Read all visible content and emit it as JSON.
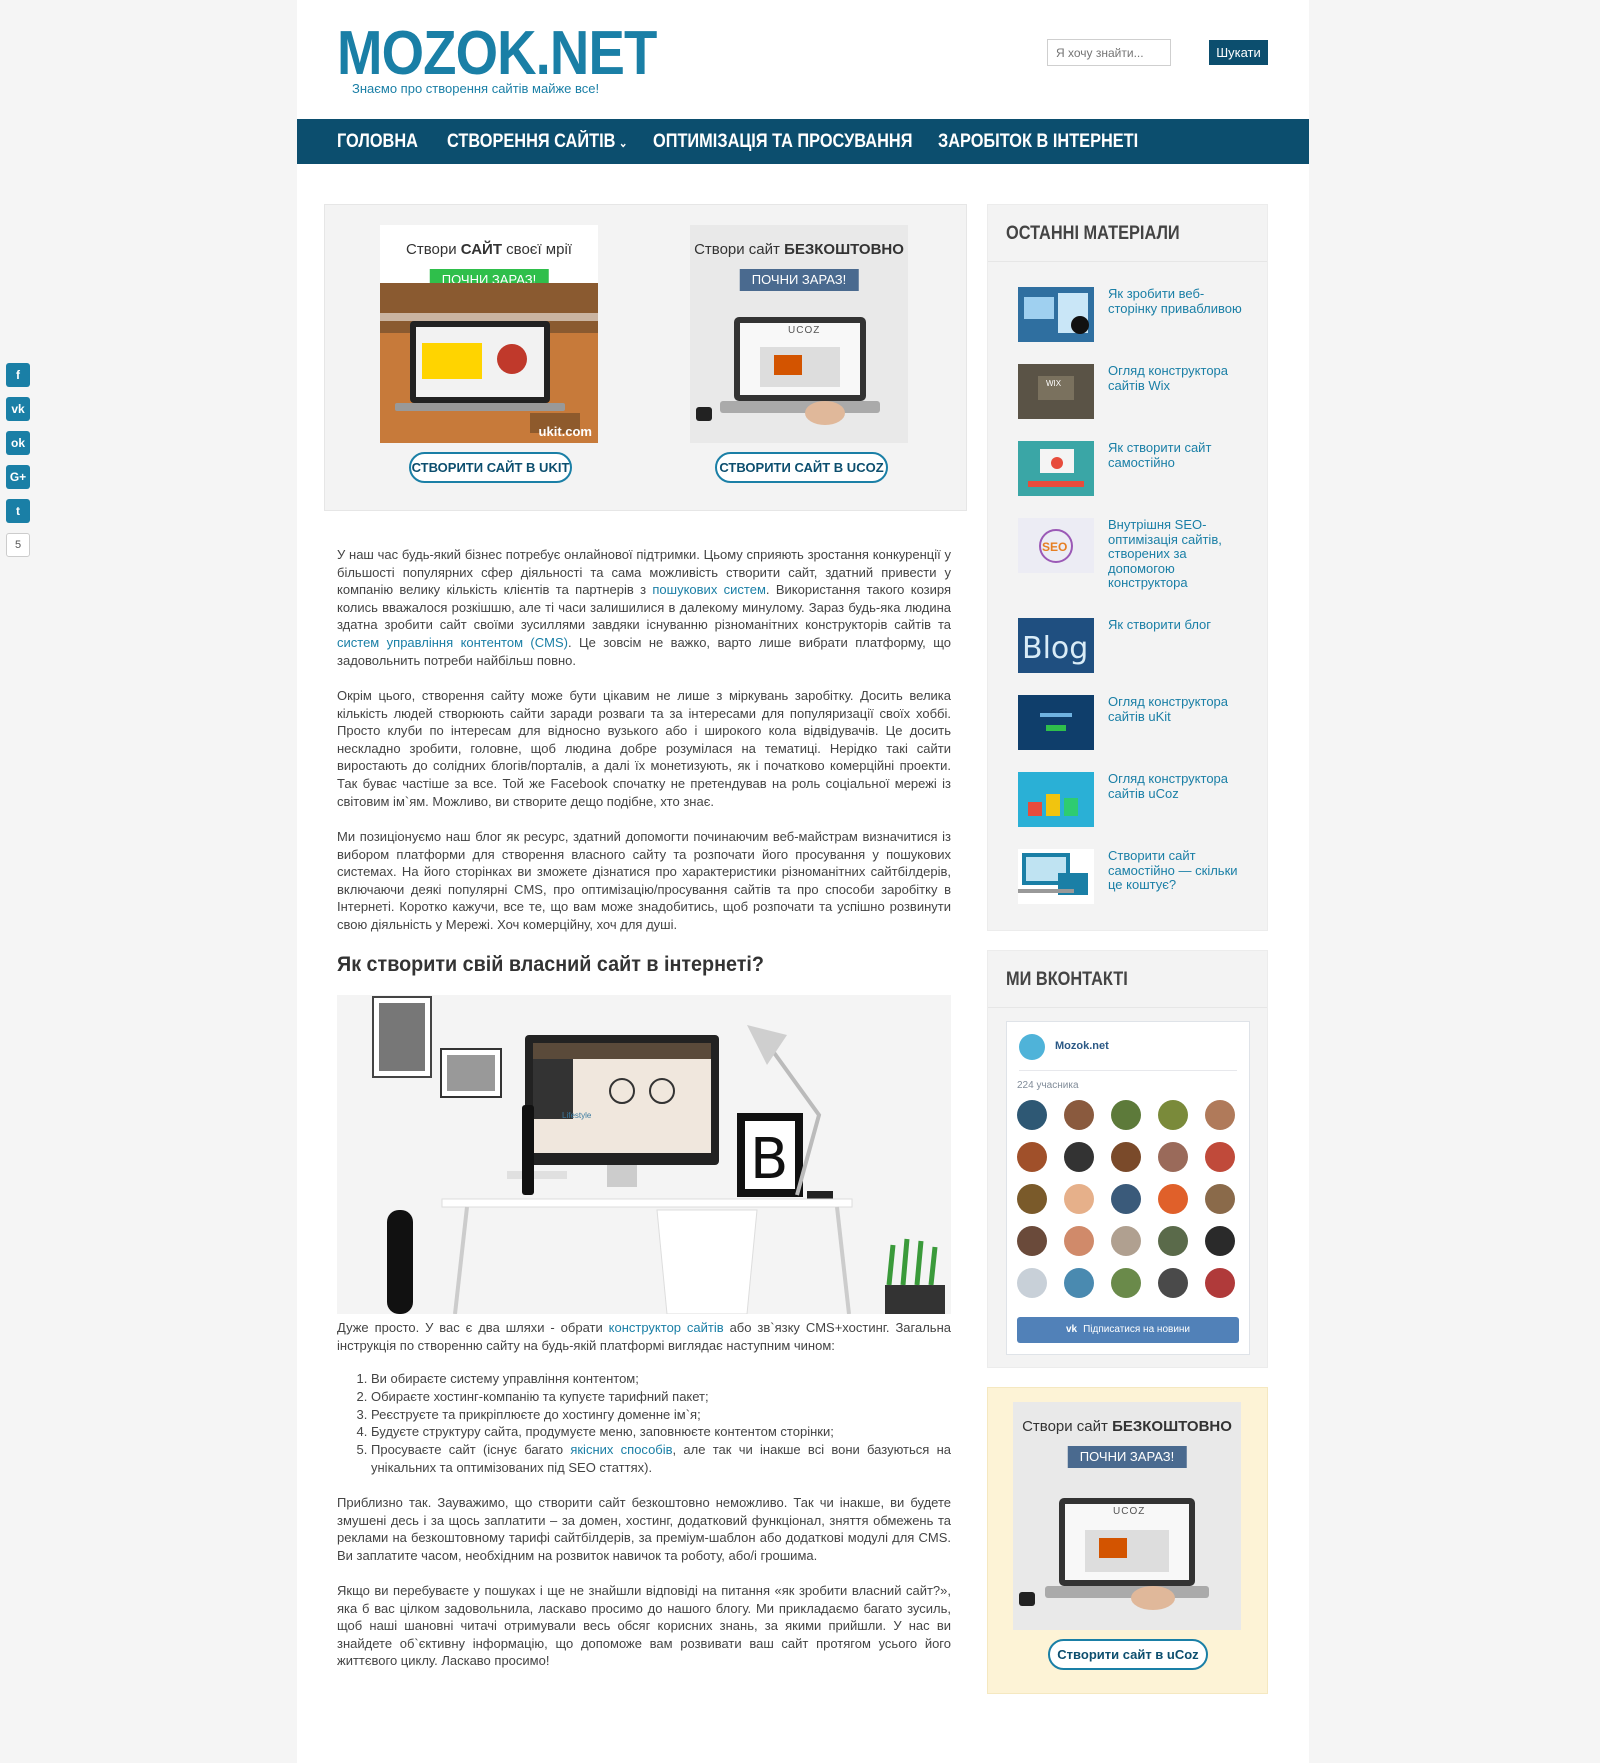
{
  "header": {
    "logo": "MOZOK.NET",
    "tagline": "Знаємо про створення сайтів майже все!",
    "search_placeholder": "Я хочу знайти...",
    "search_button": "Шукати"
  },
  "nav": {
    "items": [
      "ГОЛОВНА",
      "СТВОРЕННЯ САЙТІВ",
      "ОПТИМІЗАЦІЯ ТА ПРОСУВАННЯ",
      "ЗАРОБІТОК В ІНТЕРНЕТІ"
    ],
    "chevron_icon": "chevron-down-icon"
  },
  "promo": {
    "banner1": {
      "text_a": "Створи ",
      "text_b": "САЙТ",
      "text_c": " своєї мрії",
      "cta": "ПОЧНИ ЗАРАЗ!",
      "brand": "ukit.com",
      "accent": "#2fbf4b"
    },
    "banner2": {
      "text_a": "Створи сайт ",
      "text_b": "БЕЗКОШТОВНО",
      "cta": "ПОЧНИ ЗАРАЗ!",
      "brand": "UCOZ",
      "accent": "#4a6a8f"
    },
    "button1": "СТВОРИТИ САЙТ В UKIT",
    "button2": "СТВОРИТИ САЙТ В UCOZ"
  },
  "article": {
    "p1": [
      "У наш час будь-який бізнес потребує онлайнової підтримки. Цьому сприяють зростання конкуренції у більшості популярних сфер діяльності та сама можливість створити сайт, здатний привести у компанію велику кількість клієнтів та партнерів з ",
      "пошукових систем",
      ". Використання такого козиря колись вважалося розкішшю, але ті часи залишилися в далекому минулому. Зараз будь-яка людина здатна зробити сайт своїми зусиллями завдяки існуванню різноманітних конструкторів сайтів та ",
      "систем управління контентом (CMS)",
      ". Це зовсім не важко, варто лише вибрати платформу, що задовольнить потреби найбільш повно."
    ],
    "p2": "Окрім цього, створення сайту може бути цікавим не лише з міркувань заробітку. Досить велика кількість людей створюють сайти заради розваги та за інтересами для популяризації своїх хоббі. Просто клуби по інтересам для відносно вузького або і широкого кола відвідувачів. Це досить нескладно зробити, головне, щоб людина добре розумілася на тематиці. Нерідко такі сайти виростають до солідних блогів/порталів, а далі їх монетизують, як і початково комерційні проекти. Так буває частіше за все. Той же Facebook спочатку не претендував на роль соціальної мережі із світовим ім`ям. Можливо, ви створите дещо подібне, хто знає.",
    "p3": "Ми позиціонуємо наш блог як ресурс, здатний допомогти починаючим веб-майстрам визначитися із вибором платформи для створення власного сайту та розпочати його просування у пошукових системах. На його сторінках ви зможете дізнатися про характеристики різноманітних сайтбілдерів, включаючи деякі популярні CMS, про оптимізацію/просування сайтів та про способи заробітку в Інтернеті. Коротко кажучи, все те, що вам може знадобитись, щоб розпочати та успішно розвинути свою діяльність у Мережі. Хоч комерційну, хоч для душі.",
    "heading": "Як створити свій власний сайт в інтернеті?",
    "hero_text": "Lifestyle",
    "p4": [
      "Дуже просто. У вас є два шляхи - обрати ",
      "конструктор сайтів",
      " або зв`язку CMS+хостинг. Загальна інструкція по створенню сайту на будь-якій платформі виглядає наступним чином:"
    ],
    "list": [
      "Ви обираєте систему управління контентом;",
      "Обираєте хостинг-компанію та купуєте тарифний пакет;",
      "Реєструєте та прикріплюєте до хостингу доменне ім`я;",
      "Будуєте структуру сайта, продумуєте меню, заповнюєте контентом сторінки;"
    ],
    "list5": [
      "Просуваєте сайт (існує багато ",
      "якісних способів",
      ", але так чи інакше всі вони базуються на унікальних та оптимізованих під SEO статтях)."
    ],
    "p5": "Приблизно так. Зауважимо, що створити сайт безкоштовно неможливо. Так чи інакше, ви будете змушені десь і за щось заплатити – за домен, хостинг, додатковий функціонал, зняття обмежень та реклами на безкоштовному тарифі сайтбілдерів, за преміум-шаблон або додаткові модулі для CMS. Ви заплатите часом, необхідним на розвиток навичок та роботу, або/і грошима.",
    "p6": "Якщо ви перебуваєте у пошуках і ще не знайшли відповіді на питання «як зробити власний сайт?», яка б вас цілком задовольнила, ласкаво просимо до нашого блогу. Ми прикладаємо багато зусиль, щоб наші шановні читачі отримували весь обсяг корисних знань, за якими прийшли. У нас ви знайдете об`єктивну інформацію, що допоможе вам розвивати ваш сайт протягом усього його життєвого циклу. Ласкаво просимо!"
  },
  "sidebar": {
    "recent_title": "ОСТАННІ МАТЕРІАЛИ",
    "posts": [
      {
        "title": "Як зробити веб-сторінку привабливою",
        "thumb": "#2f6fa0"
      },
      {
        "title": "Огляд конструктора сайтів Wix",
        "thumb": "#5a5346"
      },
      {
        "title": "Як створити сайт самостійно",
        "thumb": "#3aa6a6"
      },
      {
        "title": "Внутрішня SEO-оптимізація сайтів, створених за допомогою конструктора",
        "thumb": "#d9d9e6"
      },
      {
        "title": "Як створити блог",
        "thumb": "#1f4f80"
      },
      {
        "title": "Огляд конструктора сайтів uKit",
        "thumb": "#0f3e6b"
      },
      {
        "title": "Огляд конструктора сайтів uCoz",
        "thumb": "#2ab0d6"
      },
      {
        "title": "Створити сайт самостійно — скільки це коштує?",
        "thumb": "#ffffff"
      }
    ],
    "vk_title": "МИ ВКОНТАКТІ",
    "vk_group": "Mozok.net",
    "vk_members": "224 учасника",
    "vk_button": "Підписатися на новини",
    "vk_avatar_colors": [
      "#2e5874",
      "#8a5a3e",
      "#5d7a3a",
      "#7a8a3a",
      "#b07a5a",
      "#a0502a",
      "#333333",
      "#7a4a2a",
      "#9a6a5a",
      "#c04a3a",
      "#7a5a2a",
      "#e6b08a",
      "#3a5a7a",
      "#e0602a",
      "#8a6a4a",
      "#6a4a3a",
      "#d08a6a",
      "#b0a090",
      "#5a6a4a",
      "#2a2a2a",
      "#c8d0d8",
      "#4a8ab0",
      "#6a8a4a",
      "#4a4a4a",
      "#b03a3a"
    ],
    "ad": {
      "text_a": "Створи сайт ",
      "text_b": "БЕЗКОШТОВНО",
      "cta": "ПОЧНИ ЗАРАЗ!",
      "brand": "UCOZ",
      "button": "Створити сайт в uCoz"
    }
  },
  "share": {
    "icons": [
      "facebook-icon",
      "vk-icon",
      "odnoklassniki-icon",
      "google-plus-icon",
      "twitter-icon"
    ],
    "glyphs": [
      "f",
      "vk",
      "ok",
      "G+",
      "t"
    ],
    "count": "5"
  }
}
